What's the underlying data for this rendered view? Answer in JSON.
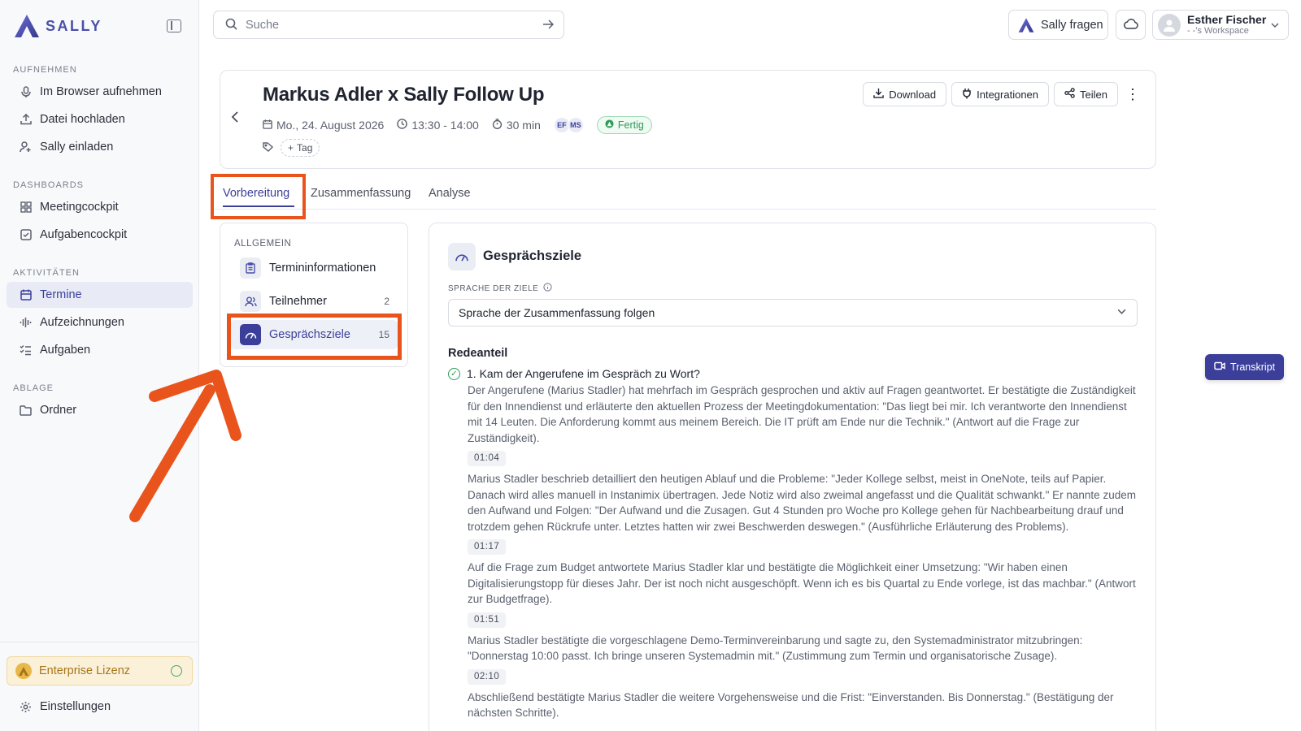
{
  "sidebar": {
    "logo_text": "SALLY",
    "sections": {
      "record": "AUFNEHMEN",
      "dashboards": "DASHBOARDS",
      "activities": "AKTIVITÄTEN",
      "storage": "ABLAGE"
    },
    "items": {
      "browser_record": "Im Browser aufnehmen",
      "upload": "Datei hochladen",
      "invite": "Sally einladen",
      "meetingcockpit": "Meetingcockpit",
      "taskcockpit": "Aufgabencockpit",
      "appointments": "Termine",
      "recordings": "Aufzeichnungen",
      "tasks": "Aufgaben",
      "folders": "Ordner"
    },
    "active_item": "Termine",
    "enterprise_label": "Enterprise Lizenz",
    "settings_label": "Einstellungen"
  },
  "topbar": {
    "search_placeholder": "Suche",
    "ask_label": "Sally fragen",
    "user_name": "Esther Fischer",
    "workspace": "- -'s Workspace"
  },
  "meeting": {
    "title": "Markus Adler x Sally Follow Up",
    "date": "Mo., 24. August 2026",
    "time": "13:30 - 14:00",
    "duration": "30 min",
    "participants_initials": [
      "EF",
      "MS"
    ],
    "status": "Fertig",
    "tag_label": "Tag",
    "actions": {
      "download": "Download",
      "integrations": "Integrationen",
      "share": "Teilen"
    }
  },
  "tabs": [
    "Vorbereitung",
    "Zusammenfassung",
    "Analyse"
  ],
  "active_tab": "Vorbereitung",
  "left_panel": {
    "title": "ALLGEMEIN",
    "items": [
      {
        "label": "Termininformationen",
        "count": ""
      },
      {
        "label": "Teilnehmer",
        "count": "2"
      },
      {
        "label": "Gesprächsziele",
        "count": "15"
      }
    ]
  },
  "goals": {
    "title": "Gesprächsziele",
    "language_label": "SPRACHE DER ZIELE",
    "language_value": "Sprache der Zusammenfassung folgen",
    "section_title": "Redeanteil",
    "question": "1. Kam der Angerufene im Gespräch zu Wort?",
    "answers": [
      {
        "text": "Der Angerufene (Marius Stadler) hat mehrfach im Gespräch gesprochen und aktiv auf Fragen geantwortet. Er bestätigte die Zuständigkeit für den Innendienst und erläuterte den aktuellen Prozess der Meetingdokumentation: \"Das liegt bei mir. Ich verantworte den Innendienst mit 14 Leuten. Die Anforderung kommt aus meinem Bereich. Die IT prüft am Ende nur die Technik.\" (Antwort auf die Frage zur Zuständigkeit).",
        "timestamp": "01:04"
      },
      {
        "text": "Marius Stadler beschrieb detailliert den heutigen Ablauf und die Probleme: \"Jeder Kollege selbst, meist in OneNote, teils auf Papier. Danach wird alles manuell in Instanimix übertragen. Jede Notiz wird also zweimal angefasst und die Qualität schwankt.\" Er nannte zudem den Aufwand und Folgen: \"Der Aufwand und die Zusagen. Gut 4 Stunden pro Woche pro Kollege gehen für Nachbearbeitung drauf und trotzdem gehen Rückrufe unter. Letztes hatten wir zwei Beschwerden deswegen.\" (Ausführliche Erläuterung des Problems).",
        "timestamp": "01:17"
      },
      {
        "text": "Auf die Frage zum Budget antwortete Marius Stadler klar und bestätigte die Möglichkeit einer Umsetzung: \"Wir haben einen Digitalisierungstopp für dieses Jahr. Der ist noch nicht ausgeschöpft. Wenn ich es bis Quartal zu Ende vorlege, ist das machbar.\" (Antwort zur Budgetfrage).",
        "timestamp": "01:51"
      },
      {
        "text": "Marius Stadler bestätigte die vorgeschlagene Demo-Terminvereinbarung und sagte zu, den Systemadministrator mitzubringen: \"Donnerstag 10:00 passt. Ich bringe unseren Systemadmin mit.\" (Zustimmung zum Termin und organisatorische Zusage).",
        "timestamp": "02:10"
      },
      {
        "text": "Abschließend bestätigte Marius Stadler die weitere Vorgehensweise und die Frist: \"Einverstanden. Bis Donnerstag.\" (Bestätigung der nächsten Schritte).",
        "timestamp": ""
      }
    ]
  },
  "transcript_label": "Transkript",
  "colors": {
    "accent": "#3b3f9a",
    "highlight": "#e8541c",
    "success": "#2e9b57"
  }
}
